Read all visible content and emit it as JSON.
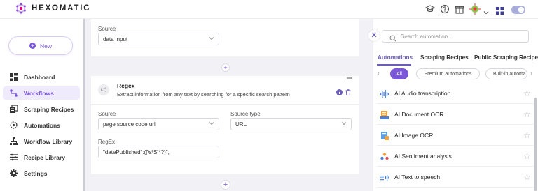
{
  "app": {
    "brand": "HEXOMATIC"
  },
  "sidebar": {
    "new_label": "New",
    "items": [
      {
        "label": "Dashboard",
        "icon": "dashboard-icon"
      },
      {
        "label": "Workflows",
        "icon": "workflows-icon",
        "active": true
      },
      {
        "label": "Scraping Recipes",
        "icon": "scraping-recipes-icon"
      },
      {
        "label": "Automations",
        "icon": "automations-icon"
      },
      {
        "label": "Workflow Library",
        "icon": "workflow-library-icon"
      },
      {
        "label": "Recipe Library",
        "icon": "recipe-library-icon"
      },
      {
        "label": "Settings",
        "icon": "settings-icon"
      }
    ]
  },
  "step1": {
    "source_label": "Source",
    "source_value": "data input"
  },
  "regex_card": {
    "title": "Regex",
    "description": "Extract information from any text by searching for a specific search pattern",
    "source_label": "Source",
    "source_value": "page source code url",
    "source_type_label": "Source type",
    "source_type_value": "URL",
    "regex_label": "RegEx",
    "regex_value": "\"datePublished\":([\\s\\S]*?)\","
  },
  "panel": {
    "search_placeholder": "Search automation...",
    "tabs": [
      "Automations",
      "Scraping Recipes",
      "Public Scraping Recipes"
    ],
    "filters": [
      "All",
      "Premium automations",
      "Built-in automa"
    ],
    "automations": [
      {
        "name": "AI Audio transcription",
        "icon": "audio-waveform-icon"
      },
      {
        "name": "AI Document OCR",
        "icon": "document-ocr-icon"
      },
      {
        "name": "AI Image OCR",
        "icon": "image-ocr-icon"
      },
      {
        "name": "AI Sentiment analysis",
        "icon": "sentiment-analysis-icon"
      },
      {
        "name": "AI Text to speech",
        "icon": "text-to-speech-icon"
      }
    ]
  },
  "colors": {
    "accent": "#7a58d8",
    "panel_accent": "#6b5cb8"
  }
}
